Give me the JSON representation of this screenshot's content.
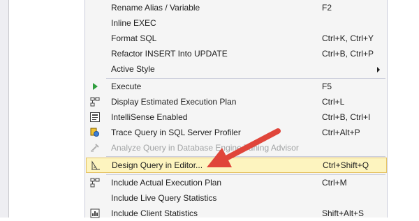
{
  "menu": {
    "items": [
      {
        "label": "Rename Alias / Variable",
        "shortcut": "F2"
      },
      {
        "label": "Inline EXEC",
        "shortcut": ""
      },
      {
        "label": "Format SQL",
        "shortcut": "Ctrl+K, Ctrl+Y"
      },
      {
        "label": "Refactor INSERT Into UPDATE",
        "shortcut": "Ctrl+B, Ctrl+P"
      },
      {
        "label": "Active Style",
        "shortcut": ""
      },
      {
        "label": "Execute",
        "shortcut": "F5"
      },
      {
        "label": "Display Estimated Execution Plan",
        "shortcut": "Ctrl+L"
      },
      {
        "label": "IntelliSense Enabled",
        "shortcut": "Ctrl+B, Ctrl+I"
      },
      {
        "label": "Trace Query in SQL Server Profiler",
        "shortcut": "Ctrl+Alt+P"
      },
      {
        "label": "Analyze Query in Database Engine Tuning Advisor",
        "shortcut": ""
      },
      {
        "label": "Design Query in Editor...",
        "shortcut": "Ctrl+Shift+Q"
      },
      {
        "label": "Include Actual Execution Plan",
        "shortcut": "Ctrl+M"
      },
      {
        "label": "Include Live Query Statistics",
        "shortcut": ""
      },
      {
        "label": "Include Client Statistics",
        "shortcut": "Shift+Alt+S"
      }
    ]
  },
  "colors": {
    "highlight_bg": "#fdf4bf",
    "highlight_border": "#e5c365",
    "annotation_arrow": "#e0453a",
    "execute_icon": "#2e9e3e"
  },
  "icons": {
    "execute": "play-icon",
    "estimated_plan": "execution-plan-icon",
    "intellisense": "intellisense-icon",
    "trace": "profiler-icon",
    "tuning": "tuning-advisor-icon",
    "design": "query-designer-icon",
    "actual_plan": "execution-plan-icon",
    "client_stats": "client-statistics-icon"
  }
}
